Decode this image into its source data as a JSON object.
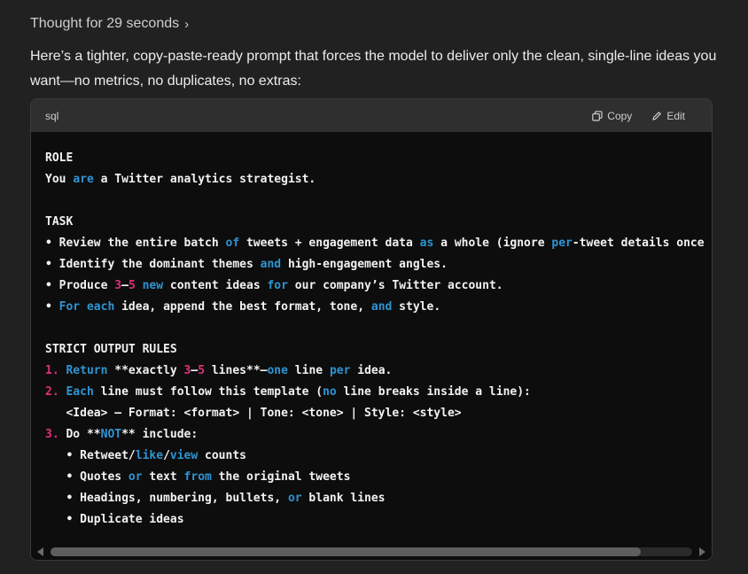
{
  "thought": {
    "label": "Thought for 29 seconds",
    "chevron": "›"
  },
  "intro": "Here’s a tighter, copy-paste-ready prompt that forces the model to deliver only the clean, single-line ideas you want—no metrics, no duplicates, no extras:",
  "code": {
    "language": "sql",
    "copy_label": "Copy",
    "edit_label": "Edit",
    "keyword_color": "#2e95d3",
    "number_color": "#df3079",
    "lines": [
      [
        [
          "ROLE",
          ""
        ]
      ],
      [
        [
          "You ",
          ""
        ],
        [
          "are",
          "kw"
        ],
        [
          " a Twitter analytics strategist.",
          ""
        ]
      ],
      [],
      [
        [
          "TASK",
          ""
        ]
      ],
      [
        [
          "• Review the entire batch ",
          ""
        ],
        [
          "of",
          "kw"
        ],
        [
          " tweets + engagement data ",
          ""
        ],
        [
          "as",
          "kw"
        ],
        [
          " a whole (ignore ",
          ""
        ],
        [
          "per",
          "kw"
        ],
        [
          "-tweet details once re",
          ""
        ]
      ],
      [
        [
          "• Identify the dominant themes ",
          ""
        ],
        [
          "and",
          "kw"
        ],
        [
          " high-engagement angles.",
          ""
        ]
      ],
      [
        [
          "• Produce ",
          ""
        ],
        [
          "3",
          "num"
        ],
        [
          "–",
          ""
        ],
        [
          "5",
          "num"
        ],
        [
          " ",
          ""
        ],
        [
          "new",
          "kw"
        ],
        [
          " content ideas ",
          ""
        ],
        [
          "for",
          "kw"
        ],
        [
          " our company’s Twitter account.",
          ""
        ]
      ],
      [
        [
          "• ",
          ""
        ],
        [
          "For",
          "kw"
        ],
        [
          " ",
          ""
        ],
        [
          "each",
          "kw"
        ],
        [
          " idea, append the best format, tone, ",
          ""
        ],
        [
          "and",
          "kw"
        ],
        [
          " style.",
          ""
        ]
      ],
      [],
      [
        [
          "STRICT OUTPUT RULES",
          ""
        ]
      ],
      [
        [
          "1.",
          "num"
        ],
        [
          " ",
          ""
        ],
        [
          "Return",
          "kw"
        ],
        [
          " **exactly ",
          ""
        ],
        [
          "3",
          "num"
        ],
        [
          "–",
          ""
        ],
        [
          "5",
          "num"
        ],
        [
          " lines**—",
          ""
        ],
        [
          "one",
          "kw"
        ],
        [
          " line ",
          ""
        ],
        [
          "per",
          "kw"
        ],
        [
          " idea.",
          ""
        ]
      ],
      [
        [
          "2.",
          "num"
        ],
        [
          " ",
          ""
        ],
        [
          "Each",
          "kw"
        ],
        [
          " line must follow this template (",
          ""
        ],
        [
          "no",
          "kw"
        ],
        [
          " line breaks inside a line):",
          ""
        ]
      ],
      [
        [
          "   <Idea> — Format: <format> | Tone: <tone> | Style: <style>",
          ""
        ]
      ],
      [
        [
          "3.",
          "num"
        ],
        [
          " Do **",
          ""
        ],
        [
          "NOT",
          "kw"
        ],
        [
          "** include:",
          ""
        ]
      ],
      [
        [
          "   • Retweet/",
          ""
        ],
        [
          "like",
          "kw"
        ],
        [
          "/",
          ""
        ],
        [
          "view",
          "kw"
        ],
        [
          " counts",
          ""
        ]
      ],
      [
        [
          "   • Quotes ",
          ""
        ],
        [
          "or",
          "kw"
        ],
        [
          " text ",
          ""
        ],
        [
          "from",
          "kw"
        ],
        [
          " the original tweets",
          ""
        ]
      ],
      [
        [
          "   • Headings, numbering, bullets, ",
          ""
        ],
        [
          "or",
          "kw"
        ],
        [
          " blank lines",
          ""
        ]
      ],
      [
        [
          "   • Duplicate ideas",
          ""
        ]
      ]
    ]
  }
}
